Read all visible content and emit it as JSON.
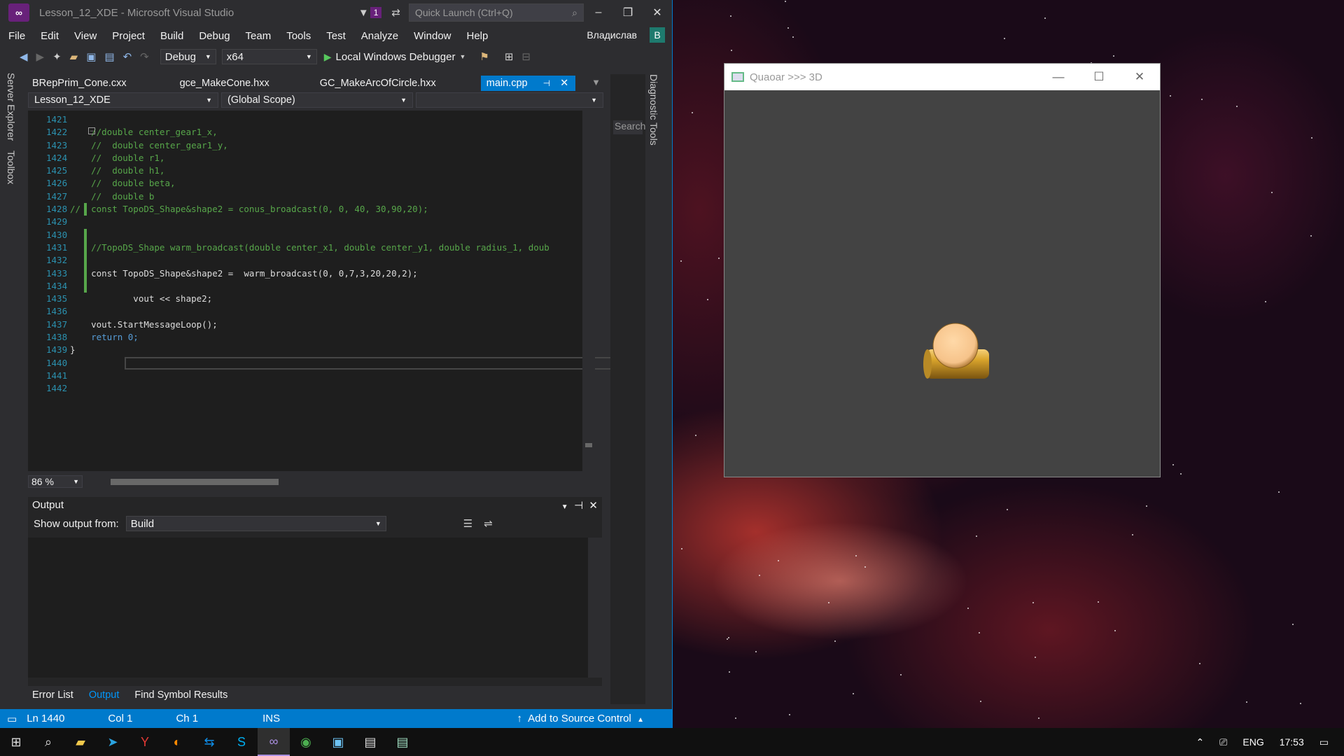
{
  "vs": {
    "title": "Lesson_12_XDE - Microsoft Visual Studio",
    "notification_count": "1",
    "quick_launch_placeholder": "Quick Launch (Ctrl+Q)",
    "menu": [
      "File",
      "Edit",
      "View",
      "Project",
      "Build",
      "Debug",
      "Team",
      "Tools",
      "Test",
      "Analyze",
      "Window",
      "Help"
    ],
    "user": "Владислав",
    "user_initial": "В",
    "toolbar": {
      "config": "Debug",
      "platform": "x64",
      "debugger": "Local Windows Debugger"
    },
    "left_tabs": [
      "Server Explorer",
      "Toolbox"
    ],
    "doc_tabs": [
      "BRepPrim_Cone.cxx",
      "gce_MakeCone.hxx",
      "GC_MakeArcOfCircle.hxx",
      "main.cpp"
    ],
    "nav": {
      "project": "Lesson_12_XDE",
      "scope": "(Global Scope)"
    },
    "code": [
      {
        "n": "1421",
        "t": ""
      },
      {
        "n": "1422",
        "t": "    //double center_gear1_x,"
      },
      {
        "n": "1423",
        "t": "    //  double center_gear1_y,"
      },
      {
        "n": "1424",
        "t": "    //  double r1,"
      },
      {
        "n": "1425",
        "t": "    //  double h1,"
      },
      {
        "n": "1426",
        "t": "    //  double beta,"
      },
      {
        "n": "1427",
        "t": "    //  double b"
      },
      {
        "n": "1428",
        "t": "//  const TopoDS_Shape&shape2 = conus_broadcast(0, 0, 40, 30,90,20);"
      },
      {
        "n": "1429",
        "t": ""
      },
      {
        "n": "1430",
        "t": ""
      },
      {
        "n": "1431",
        "t": "    //TopoDS_Shape warm_broadcast(double center_x1, double center_y1, double radius_1, doub"
      },
      {
        "n": "1432",
        "t": ""
      },
      {
        "n": "1433",
        "t": "    const TopoDS_Shape&shape2 =  warm_broadcast(0, 0,7,3,20,20,2);"
      },
      {
        "n": "1434",
        "t": ""
      },
      {
        "n": "1435",
        "t": "            vout << shape2;"
      },
      {
        "n": "1436",
        "t": ""
      },
      {
        "n": "1437",
        "t": "    vout.StartMessageLoop();"
      },
      {
        "n": "1438",
        "t": "    return 0;"
      },
      {
        "n": "1439",
        "t": "}"
      },
      {
        "n": "1440",
        "t": ""
      },
      {
        "n": "1441",
        "t": ""
      },
      {
        "n": "1442",
        "t": ""
      }
    ],
    "zoom": "86 %",
    "diagnostic_tab": "Diagnostic Tools",
    "search_small": "Search",
    "output": {
      "title": "Output",
      "show_from_label": "Show output from:",
      "source": "Build"
    },
    "bottom_tabs": [
      "Error List",
      "Output",
      "Find Symbol Results"
    ],
    "status": {
      "ln": "Ln 1440",
      "col": "Col 1",
      "ch": "Ch 1",
      "ins": "INS",
      "source_control": "Add to Source Control"
    }
  },
  "quaoar": {
    "title": "Quaoar >>> 3D"
  },
  "taskbar": {
    "lang": "ENG",
    "time": "17:53"
  },
  "colors": {
    "accent": "#007acc",
    "comment": "#57a64a",
    "keyword": "#569cd6",
    "type": "#4ec9b0",
    "line_number": "#2b91af",
    "shape_gold": "#c9961e",
    "shape_peach": "#f7c48a"
  }
}
